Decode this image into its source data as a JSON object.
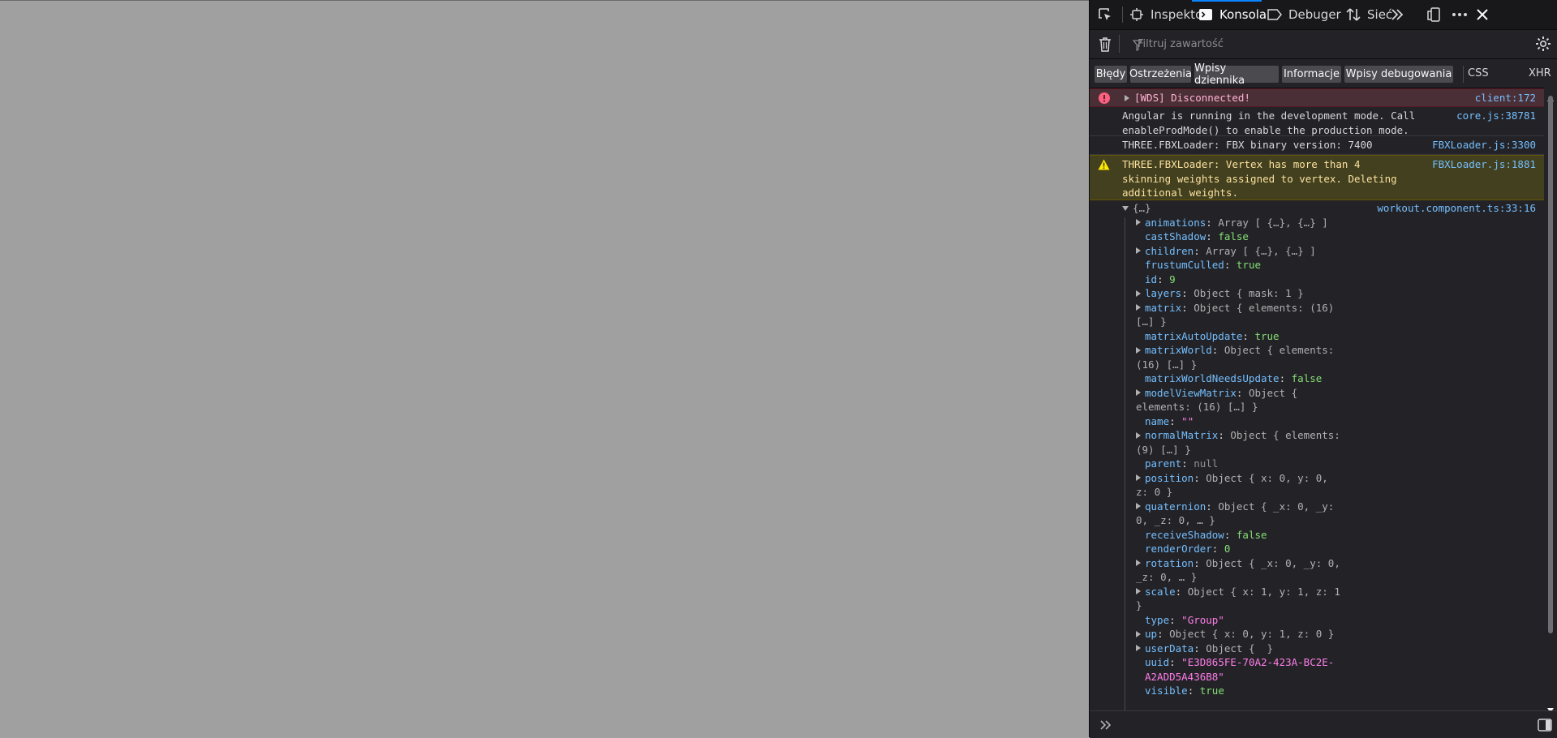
{
  "toolbar": {
    "tabs": [
      {
        "label": "Inspektor",
        "icon": "inspector-icon"
      },
      {
        "label": "Konsola",
        "icon": "console-icon",
        "selected": true
      },
      {
        "label": "Debuger",
        "icon": "debugger-icon"
      },
      {
        "label": "Sieć",
        "icon": "network-icon"
      }
    ]
  },
  "filter": {
    "placeholder": "Filtruj zawartość"
  },
  "categories": [
    "Błędy",
    "Ostrzeżenia",
    "Wpisy dziennika",
    "Informacje",
    "Wpisy debugowania"
  ],
  "extra_filters": [
    "CSS",
    "XHR"
  ],
  "messages": [
    {
      "level": "error",
      "text": "[WDS] Disconnected!",
      "location": "client:172"
    },
    {
      "level": "log",
      "text": "Angular is running in the development mode. Call\nenableProdMode() to enable the production mode.",
      "location": "core.js:38781"
    },
    {
      "level": "log",
      "text": "THREE.FBXLoader: FBX binary version: 7400",
      "location": "FBXLoader.js:3300"
    },
    {
      "level": "warning",
      "text": "THREE.FBXLoader: Vertex has more than 4\nskinning weights assigned to vertex. Deleting\nadditional weights.",
      "location": "FBXLoader.js:1881"
    },
    {
      "level": "log",
      "text": "{…}",
      "location": "workout.component.ts:33:16"
    }
  ],
  "object_props": {
    "animations": "Array [ {…}, {…} ]",
    "castShadow": "false",
    "children": "Array [ {…}, {…} ]",
    "frustumCulled": "true",
    "id": "9",
    "layers": "Object { mask: 1 }",
    "matrix_a": "Object { elements: (16)",
    "matrix_b": "[…] }",
    "matrixAutoUpdate": "true",
    "matrixWorld_a": "Object { elements:",
    "matrixWorld_b": "(16) […] }",
    "matrixWorldNeedsUpdate": "false",
    "modelViewMatrix_a": "Object {",
    "modelViewMatrix_b": "elements: (16) […] }",
    "name": "\"\"",
    "normalMatrix_a": "Object { elements:",
    "normalMatrix_b": "(9) […] }",
    "parent": "null",
    "position_a": "Object { x: 0, y: 0,",
    "position_b": "z: 0 }",
    "quaternion_a": "Object { _x: 0, _y:",
    "quaternion_b": "0, _z: 0, … }",
    "receiveShadow": "false",
    "renderOrder": "0",
    "rotation_a": "Object { _x: 0, _y: 0,",
    "rotation_b": "_z: 0, … }",
    "scale_a": "Object { x: 1, y: 1, z: 1",
    "scale_b": "}",
    "type": "\"Group\"",
    "up": "Object { x: 0, y: 1, z: 0 }",
    "userData": "Object {  }",
    "uuid_a": "\"E3D865FE-70A2-423A-BC2E-",
    "uuid_b": "A2ADD5A436B8\"",
    "visible": "true"
  },
  "colors": {
    "accent": "#0a84ff",
    "error_bg": "#4b2f36",
    "warning_bg": "#42401f",
    "key": "#75bfff",
    "value": "#86de74",
    "string": "#ff7de9"
  }
}
